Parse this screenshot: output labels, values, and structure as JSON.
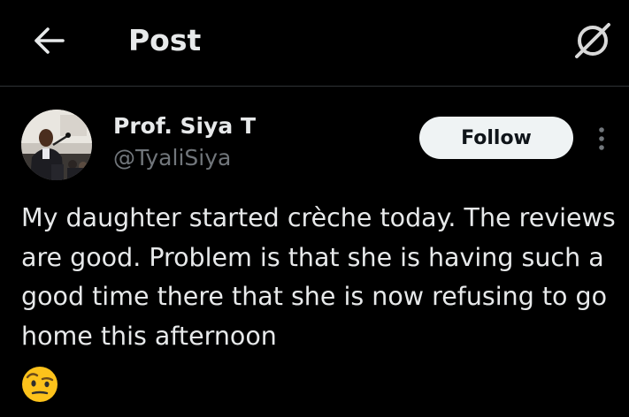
{
  "header": {
    "back_icon": "arrow-left-icon",
    "title": "Post",
    "grok_icon": "grok-slash-circle-icon"
  },
  "post": {
    "author": {
      "name": "Prof. Siya T",
      "handle": "@TyaliSiya",
      "avatar_icon": "profile-photo-speaker-at-lectern"
    },
    "follow_label": "Follow",
    "more_icon": "more-vertical-dots-icon",
    "text": "My daughter started crèche today. The reviews are good. Problem is that she is having such a good time there that she is now refusing to go home this afternoon",
    "emoji": "🤨",
    "emoji_icon": "face-with-raised-eyebrow-emoji"
  },
  "colors": {
    "background": "#000000",
    "primary_text": "#e7e9ea",
    "secondary_text": "#71767b",
    "divider": "#2f3336",
    "follow_bg": "#eff3f4",
    "follow_text": "#0f1419"
  }
}
